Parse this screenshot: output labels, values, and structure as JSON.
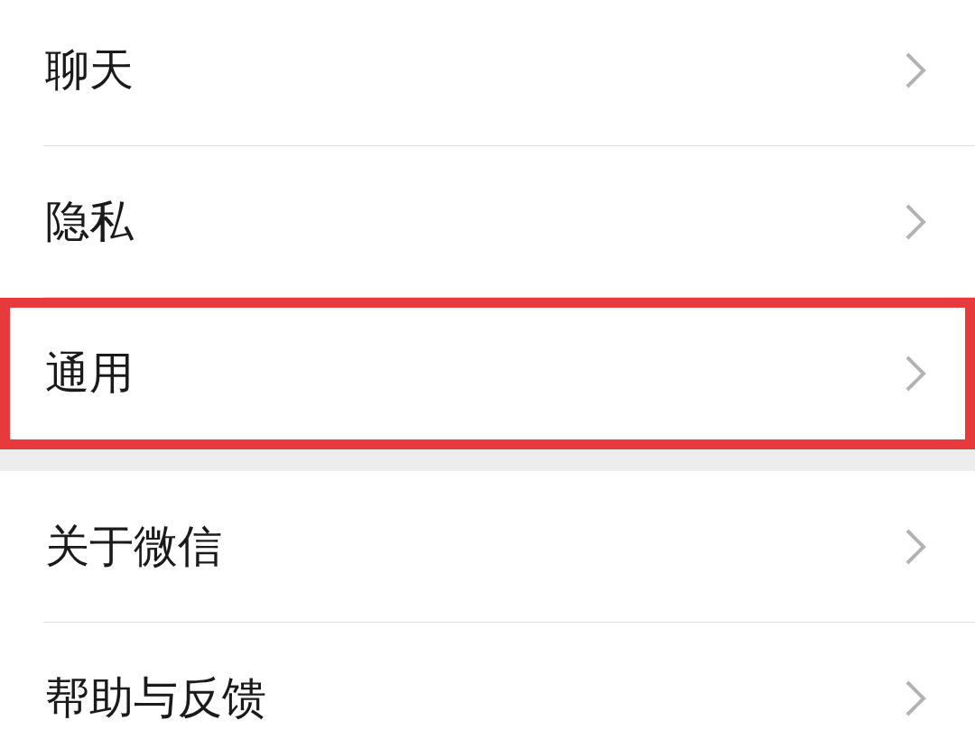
{
  "groups": [
    {
      "items": [
        {
          "label": "聊天",
          "highlighted": false
        },
        {
          "label": "隐私",
          "highlighted": false
        },
        {
          "label": "通用",
          "highlighted": true
        }
      ]
    },
    {
      "items": [
        {
          "label": "关于微信",
          "highlighted": false
        },
        {
          "label": "帮助与反馈",
          "highlighted": false
        }
      ]
    }
  ]
}
